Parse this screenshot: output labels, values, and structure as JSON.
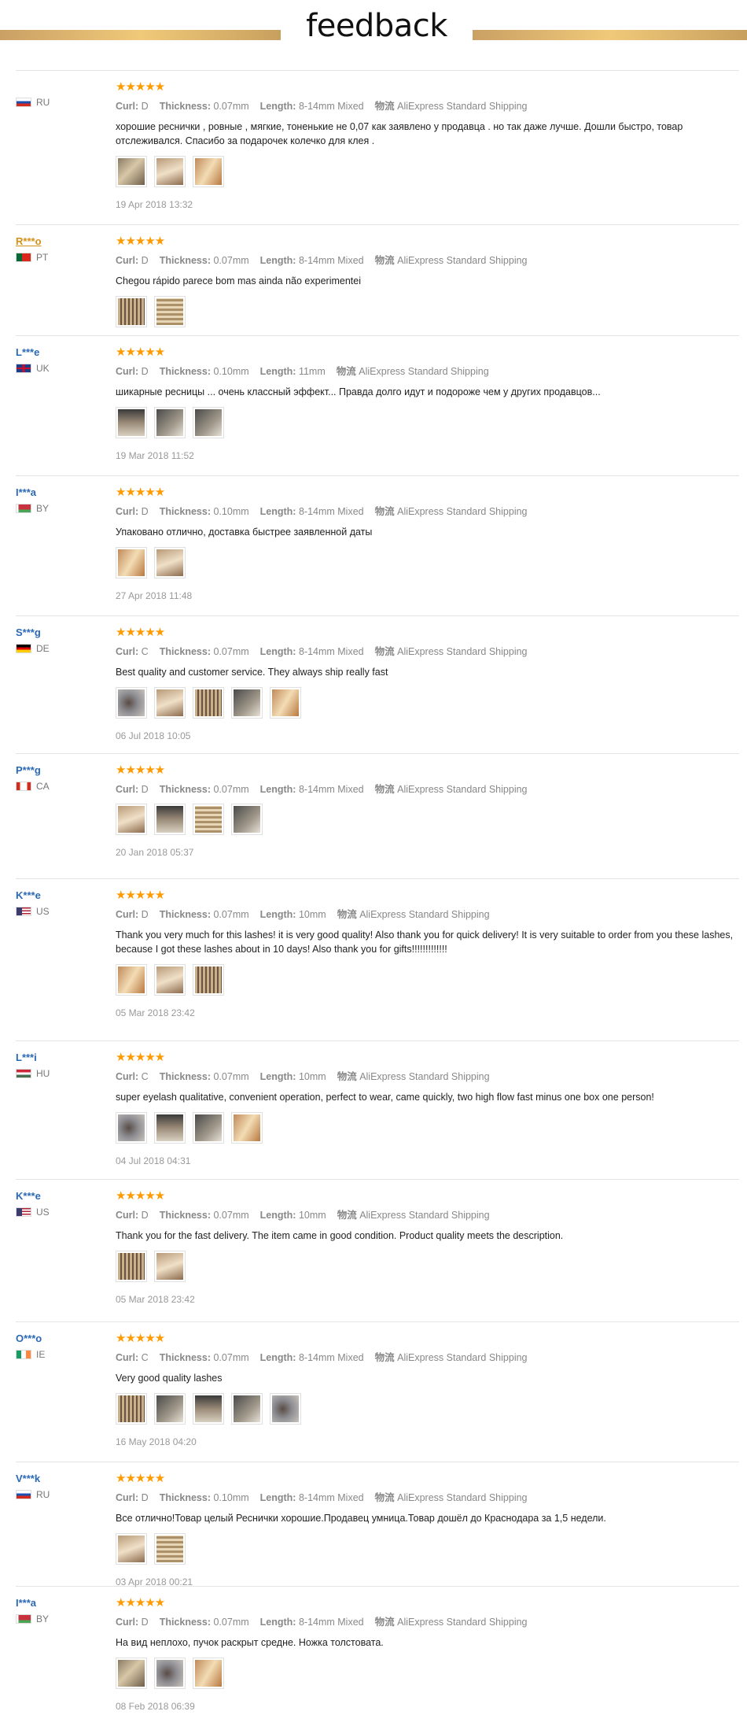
{
  "header": {
    "title": "feedback"
  },
  "labels": {
    "curl": "Curl:",
    "thickness": "Thickness:",
    "length": "Length:",
    "shipping": "物流"
  },
  "reviews": [
    {
      "user": "",
      "country": "RU",
      "flag": "ru",
      "stars": "★★★★★",
      "curl": "D",
      "thickness": "0.07mm",
      "length": "8-14mm Mixed",
      "shipping": "AliExpress Standard Shipping",
      "text": "хорошие реснички , ровные , мягкие, тоненькие не 0,07 как заявлено у продавца . но так даже лучше. Дошли быстро, товар отслеживался. Спасибо за подарочек колечко для клея .",
      "photos": [
        "a",
        "b",
        "f"
      ],
      "date": "19 Apr 2018 13:32"
    },
    {
      "user": "R***o",
      "highlight": true,
      "country": "PT",
      "flag": "pt",
      "stars": "★★★★★",
      "curl": "D",
      "thickness": "0.07mm",
      "length": "8-14mm Mixed",
      "shipping": "AliExpress Standard Shipping",
      "text": "Chegou rápido parece bom mas ainda não experimentei",
      "photos": [
        "c",
        "h"
      ],
      "date": ""
    },
    {
      "user": "L***e",
      "country": "UK",
      "flag": "uk",
      "stars": "★★★★★",
      "curl": "D",
      "thickness": "0.10mm",
      "length": "11mm",
      "shipping": "AliExpress Standard Shipping",
      "text": "шикарные ресницы ... очень классный эффект... Правда долго идут и подороже чем у других продавцов...",
      "photos": [
        "d",
        "e",
        "e"
      ],
      "date": "19 Mar 2018 11:52"
    },
    {
      "user": "I***a",
      "country": "BY",
      "flag": "by",
      "stars": "★★★★★",
      "curl": "D",
      "thickness": "0.10mm",
      "length": "8-14mm Mixed",
      "shipping": "AliExpress Standard Shipping",
      "text": "Упаковано отлично, доставка быстрее заявленной даты",
      "photos": [
        "f",
        "b"
      ],
      "date": "27 Apr 2018 11:48"
    },
    {
      "user": "S***g",
      "country": "DE",
      "flag": "de",
      "stars": "★★★★★",
      "curl": "C",
      "thickness": "0.07mm",
      "length": "8-14mm Mixed",
      "shipping": "AliExpress Standard Shipping",
      "text": "Best quality and customer service. They always ship really fast",
      "photos": [
        "g",
        "b",
        "c",
        "e",
        "f"
      ],
      "date": "06 Jul 2018 10:05"
    },
    {
      "user": "P***g",
      "country": "CA",
      "flag": "ca",
      "stars": "★★★★★",
      "curl": "D",
      "thickness": "0.07mm",
      "length": "8-14mm Mixed",
      "shipping": "AliExpress Standard Shipping",
      "text": "",
      "photos": [
        "b",
        "d",
        "h",
        "e"
      ],
      "date": "20 Jan 2018 05:37"
    },
    {
      "user": "K***e",
      "country": "US",
      "flag": "us",
      "stars": "★★★★★",
      "curl": "D",
      "thickness": "0.07mm",
      "length": "10mm",
      "shipping": "AliExpress Standard Shipping",
      "text": "Thank you very much for this lashes! it is very good quality! Also thank you for quick delivery! It is very suitable to order from you these lashes, because I got these lashes about in 10 days! Also thank you for gifts!!!!!!!!!!!!!",
      "photos": [
        "f",
        "b",
        "c"
      ],
      "date": "05 Mar 2018 23:42"
    },
    {
      "user": "L***i",
      "country": "HU",
      "flag": "hu",
      "stars": "★★★★★",
      "curl": "C",
      "thickness": "0.07mm",
      "length": "10mm",
      "shipping": "AliExpress Standard Shipping",
      "text": "super eyelash qualitative, convenient operation, perfect to wear, came quickly, two high flow fast minus one box one person!",
      "photos": [
        "g",
        "d",
        "e",
        "f"
      ],
      "date": "04 Jul 2018 04:31"
    },
    {
      "user": "K***e",
      "country": "US",
      "flag": "us",
      "stars": "★★★★★",
      "curl": "D",
      "thickness": "0.07mm",
      "length": "10mm",
      "shipping": "AliExpress Standard Shipping",
      "text": "Thank you for the fast delivery. The item came in good condition. Product quality meets the description.",
      "photos": [
        "c",
        "b"
      ],
      "date": "05 Mar 2018 23:42"
    },
    {
      "user": "O***o",
      "country": "IE",
      "flag": "ie",
      "stars": "★★★★★",
      "curl": "C",
      "thickness": "0.07mm",
      "length": "8-14mm Mixed",
      "shipping": "AliExpress Standard Shipping",
      "text": "Very good quality lashes",
      "photos": [
        "c",
        "e",
        "d",
        "e",
        "g"
      ],
      "date": "16 May 2018 04:20"
    },
    {
      "user": "V***k",
      "country": "RU",
      "flag": "ru",
      "stars": "★★★★★",
      "curl": "D",
      "thickness": "0.10mm",
      "length": "8-14mm Mixed",
      "shipping": "AliExpress Standard Shipping",
      "text": "Все отлично!Товар целый Реснички хорошие.Продавец умница.Товар дошёл до Краснодара за 1,5 недели.",
      "photos": [
        "b",
        "h"
      ],
      "date": "03 Apr 2018 00:21"
    },
    {
      "user": "I***a",
      "country": "BY",
      "flag": "by",
      "stars": "★★★★★",
      "curl": "D",
      "thickness": "0.07mm",
      "length": "8-14mm Mixed",
      "shipping": "AliExpress Standard Shipping",
      "text": "На вид неплохо, пучок раскрыт средне. Ножка толстовата.",
      "photos": [
        "a",
        "g",
        "f"
      ],
      "date": "08 Feb 2018 06:39"
    }
  ]
}
